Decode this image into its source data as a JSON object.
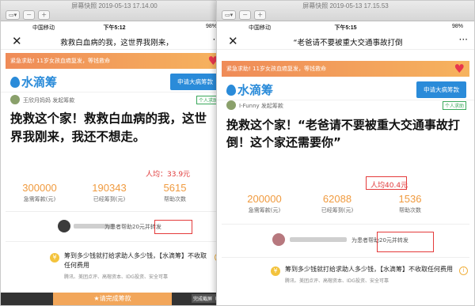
{
  "left": {
    "window_title": "屏幕快照 2019-05-13 17.14.00",
    "status": {
      "carrier": "中国移动 ",
      "time": "下午5:12",
      "battery": "98%"
    },
    "nav_title": "救救白血病的我，这世界我刚来，",
    "banner": "紧急求助! 11岁女孩血癌复发，等钱救命",
    "brand": "水滴筹",
    "apply_button": "申请大病筹款",
    "user": "王欣月妈妈 发起筹款",
    "tag": "个人求助",
    "headline": "挽救这个家！救救白血病的我，这世界我刚来，我还不想走。",
    "avg": "人均：33.9元",
    "stats": [
      {
        "num": "300000",
        "lbl": "急需筹款(元)"
      },
      {
        "num": "190343",
        "lbl": "已经筹到(元)"
      },
      {
        "num": "5615",
        "lbl": "帮助次数"
      }
    ],
    "help_text": "为患者帮助20元并转发",
    "faq": "筹到多少钱就打给求助人多少钱，【水滴筹】不收取任何费用",
    "faq_sub": "腾讯、美团点评、高榕资本、IDG投资、安全可靠",
    "bottom_btn": "★请完成筹款",
    "done": "完成截屏（双"
  },
  "right": {
    "window_title": "屏幕快照 2019-05-13 17.15.53",
    "status": {
      "carrier": "中国移动 ",
      "time": "下午5:15",
      "battery": "98%"
    },
    "nav_title": "“老爸请不要被重大交通事故打倒",
    "banner": "紧急求助! 11岁女孩血癌复发，等钱救命",
    "brand": "水滴筹",
    "apply_button": "申请大病筹款",
    "user": "I-Funny 发起筹款",
    "tag": "个人求助",
    "headline": "挽救这个家！“老爸请不要被重大交通事故打倒！这个家还需要你”",
    "avg": "人均40.4元",
    "stats": [
      {
        "num": "200000",
        "lbl": "急需筹款(元)"
      },
      {
        "num": "62088",
        "lbl": "已经筹到(元)"
      },
      {
        "num": "1536",
        "lbl": "帮助次数"
      }
    ],
    "help_text": "为患者帮助20元并转发",
    "faq": "筹到多少钱就打给求助人多少钱，【水滴筹】不收取任何费用",
    "faq_sub": "腾讯、美团点评、高榕资本、IDG投资、安全可靠"
  }
}
